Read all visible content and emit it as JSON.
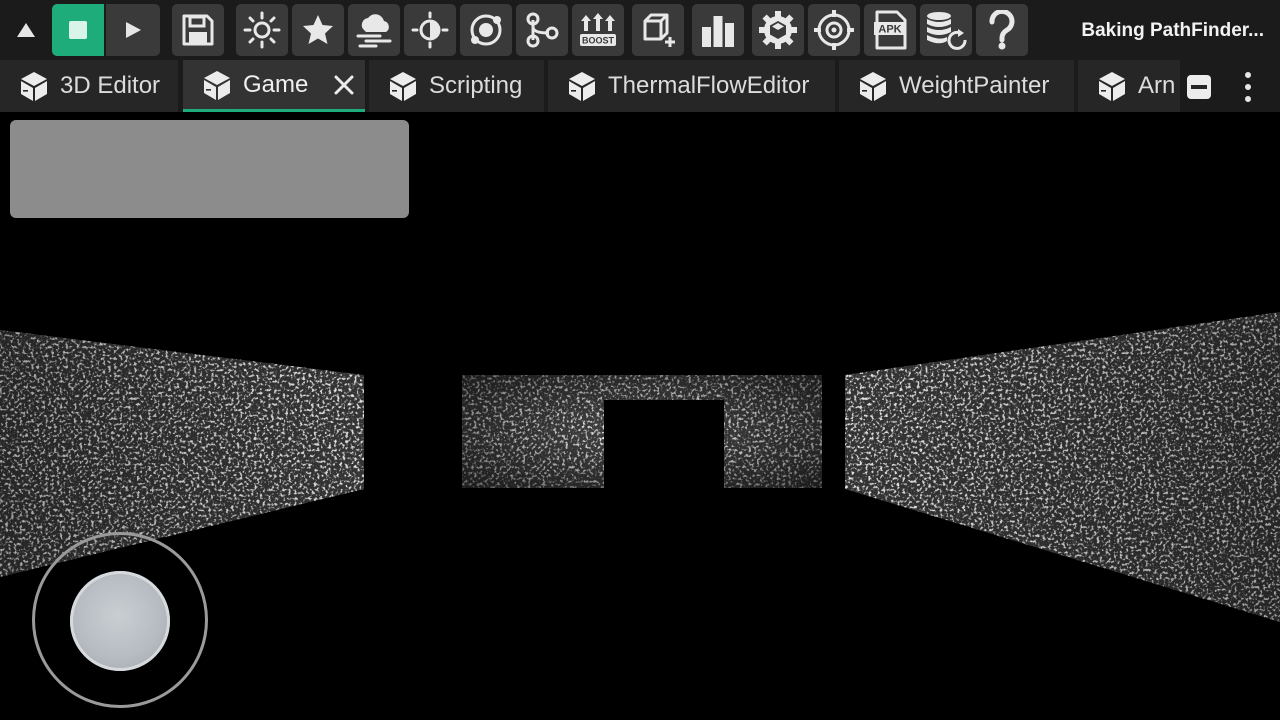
{
  "toolbar": {
    "buttons": [
      {
        "name": "collapse-toolbar-button",
        "icon": "triangle-up-icon"
      },
      {
        "name": "stop-button",
        "icon": "stop-square-icon"
      },
      {
        "name": "play-button",
        "icon": "play-triangle-icon"
      },
      {
        "name": "save-button",
        "icon": "floppy-disk-icon"
      },
      {
        "name": "lighting-button",
        "icon": "sun-rays-icon"
      },
      {
        "name": "favorites-button",
        "icon": "star-icon"
      },
      {
        "name": "weather-button",
        "icon": "cloud-wind-icon"
      },
      {
        "name": "brightness-button",
        "icon": "half-sun-icon"
      },
      {
        "name": "orbit-button",
        "icon": "orbit-icon"
      },
      {
        "name": "pathfinding-button",
        "icon": "node-graph-icon"
      },
      {
        "name": "boost-button",
        "icon": "boost-arrows-icon"
      },
      {
        "name": "add-object-button",
        "icon": "cube-plus-icon"
      },
      {
        "name": "stats-button",
        "icon": "bar-chart-icon"
      },
      {
        "name": "settings-button",
        "icon": "gear-cube-icon"
      },
      {
        "name": "target-button",
        "icon": "crosshair-gear-icon"
      },
      {
        "name": "export-apk-button",
        "icon": "apk-file-icon"
      },
      {
        "name": "database-refresh-button",
        "icon": "database-refresh-icon"
      },
      {
        "name": "help-button",
        "icon": "question-mark-icon"
      }
    ],
    "boost_label": "BOOST",
    "apk_label": "APK",
    "status_text": "Baking PathFinder..."
  },
  "tabs": [
    {
      "label": "3D Editor",
      "active": false
    },
    {
      "label": "Game",
      "active": true
    },
    {
      "label": "Scripting",
      "active": false
    },
    {
      "label": "ThermalFlowEditor",
      "active": false
    },
    {
      "label": "WeightPainter",
      "active": false
    },
    {
      "label": "Arn",
      "active": false
    }
  ],
  "colors": {
    "accent": "#1ead7a",
    "toolbar_bg": "#1b1b1b",
    "button_bg": "#3a3a3a",
    "overlay_panel": "#8c8c8c"
  }
}
